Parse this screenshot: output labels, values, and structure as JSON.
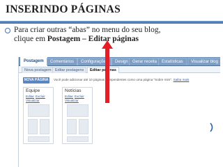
{
  "slide": {
    "title": "INSERINDO PÁGINAS",
    "bullet_line1": "Para criar outras “abas” no menu do seu blog,",
    "bullet_line2_prefix": "clique em ",
    "bullet_line2_bold": "Postagem – Editar páginas"
  },
  "blogger": {
    "tabs": [
      "Postagem",
      "Comentários",
      "Configurações",
      "Design",
      "Gerar receita",
      "Estatísticas",
      "Visualizar blog"
    ],
    "subtabs": [
      "Nova postagem",
      "Editar postagens",
      "Editar páginas"
    ],
    "new_page_button": "NOVA PÁGINA",
    "info_text": "Você pode adicionar até 10 páginas independentes como uma página \"Sobre mim\".",
    "info_link": "Saiba mais",
    "panels": [
      {
        "title": "Equipe",
        "edit": "Editar",
        "delete": "Excluir",
        "view": "Visualizar"
      },
      {
        "title": "Notícias",
        "edit": "Editar",
        "delete": "Excluir",
        "view": "Visualizar"
      }
    ]
  },
  "colors": {
    "accent": "#3d6ca8",
    "blogger_bar": "#6c8fb8",
    "arrow": "#e41e26"
  }
}
